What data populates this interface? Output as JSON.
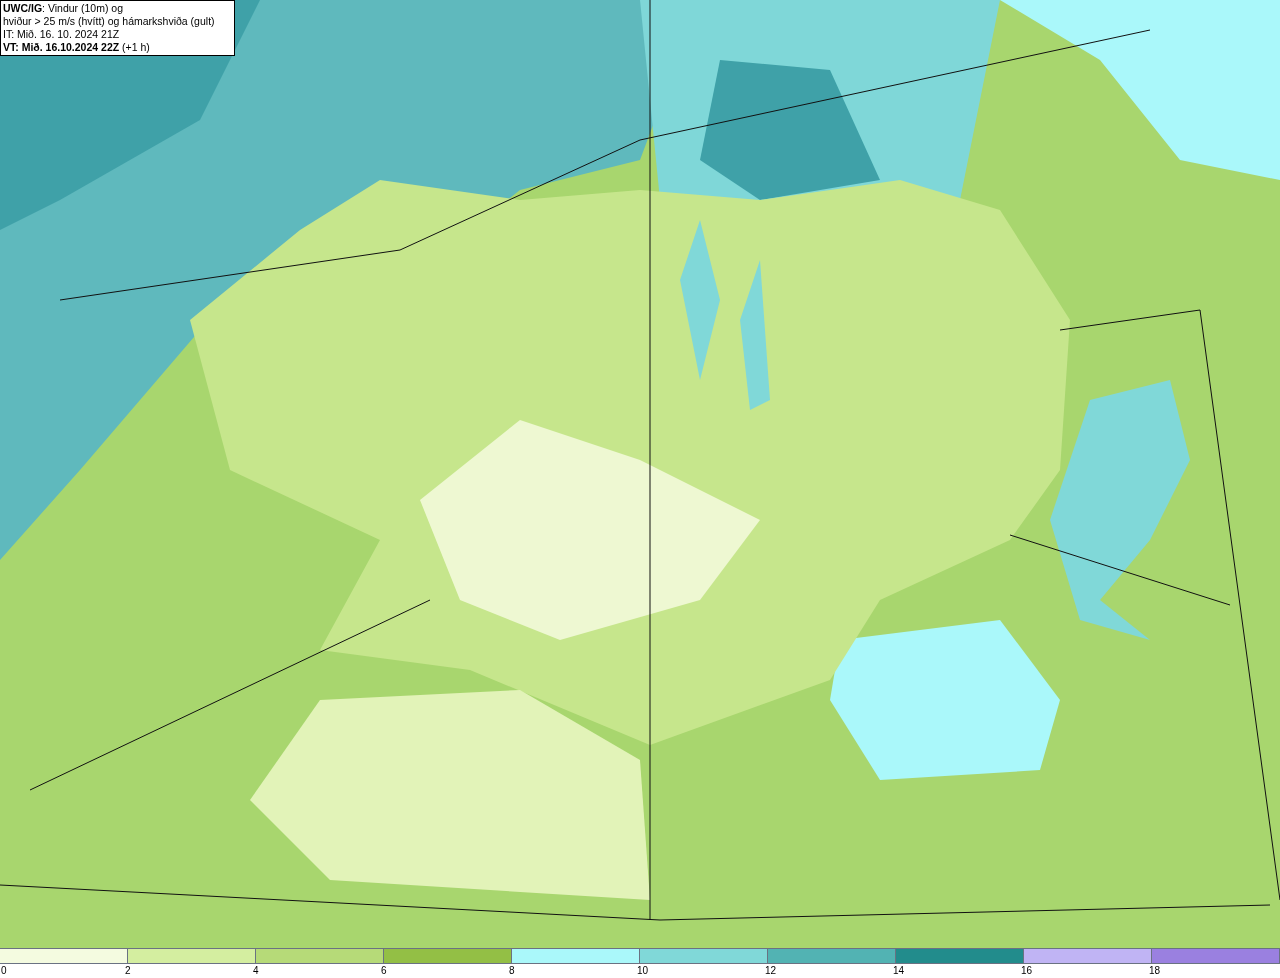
{
  "title_box": {
    "lines": [
      "**UWC/IG**: Vindur (10m) og",
      "hviður > 25 m/s (hvítt) og hámarkshviða (gult)",
      "IT: Mið. 16. 10. 2024 21Z",
      "**VT: Mið. 16.10.2024 22Z** (+1 h)"
    ]
  },
  "legend": {
    "bins": [
      {
        "color": "#f4fbe0"
      },
      {
        "color": "#d4eea0"
      },
      {
        "color": "#b6da78"
      },
      {
        "color": "#93bf45"
      },
      {
        "color": "#aaf8fa"
      },
      {
        "color": "#80d8d8"
      },
      {
        "color": "#52b3b3"
      },
      {
        "color": "#228c8c"
      },
      {
        "color": "#c0b4f4"
      },
      {
        "color": "#9a80e0"
      }
    ],
    "labels": [
      "0",
      "2",
      "4",
      "6",
      "8",
      "10",
      "12",
      "14",
      "16",
      "18"
    ]
  }
}
